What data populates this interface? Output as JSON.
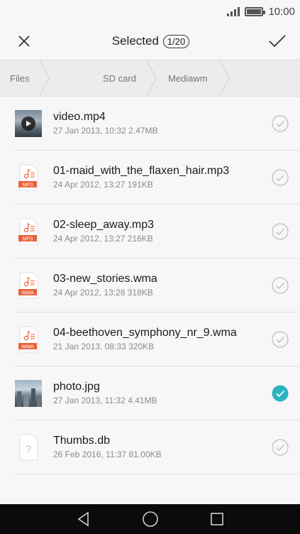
{
  "status": {
    "time": "10:00"
  },
  "header": {
    "title": "Selected",
    "count": "1/20"
  },
  "breadcrumb": [
    "Files",
    "SD card",
    "Mediawm"
  ],
  "files": [
    {
      "name": "video.mp4",
      "meta": "27 Jan 2013, 10:32 2.47MB",
      "type": "video",
      "selected": false
    },
    {
      "name": "01-maid_with_the_flaxen_hair.mp3",
      "meta": "24 Apr 2012, 13:27 191KB",
      "type": "MP3",
      "selected": false
    },
    {
      "name": "02-sleep_away.mp3",
      "meta": "24 Apr 2012, 13:27 216KB",
      "type": "MP3",
      "selected": false
    },
    {
      "name": "03-new_stories.wma",
      "meta": "24 Apr 2012, 13:28 318KB",
      "type": "WMA",
      "selected": false
    },
    {
      "name": "04-beethoven_symphony_nr_9.wma",
      "meta": "21 Jan 2013, 08:33 320KB",
      "type": "WMA",
      "selected": false
    },
    {
      "name": "photo.jpg",
      "meta": "27 Jan 2013, 11:32 4.41MB",
      "type": "photo",
      "selected": true
    },
    {
      "name": "Thumbs.db",
      "meta": "26 Feb 2016, 11:37 81.00KB",
      "type": "unknown",
      "selected": false
    }
  ],
  "colors": {
    "accent": "#2bb3c0",
    "audio_badge": "#e8623a",
    "nav_bg": "#0b0b0b"
  },
  "icons": {
    "header": [
      "close-icon",
      "checkmark-icon"
    ],
    "status": [
      "signal-icon",
      "battery-icon"
    ],
    "nav": [
      "back-icon",
      "home-icon",
      "recents-icon"
    ]
  }
}
